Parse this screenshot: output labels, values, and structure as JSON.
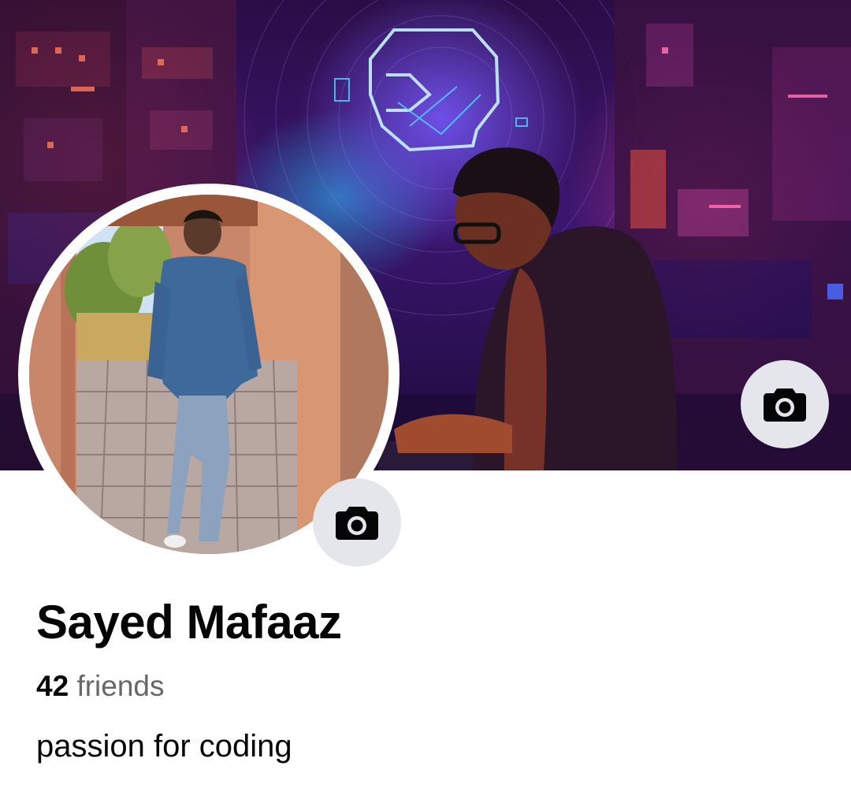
{
  "profile": {
    "name": "Sayed Mafaaz",
    "friends_count": "42",
    "friends_label": "friends",
    "bio": "passion for coding"
  },
  "icons": {
    "cover_camera": "camera-icon",
    "avatar_camera": "camera-icon"
  },
  "colors": {
    "button_bg": "#e4e6eb",
    "text_primary": "#050505",
    "text_secondary": "#65676b"
  }
}
